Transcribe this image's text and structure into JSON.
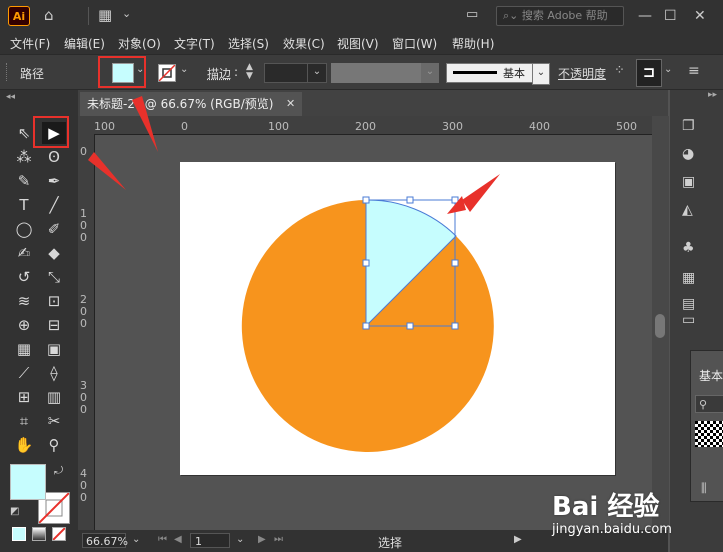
{
  "app": {
    "logo": "Ai",
    "search_placeholder": "搜索 Adobe 帮助"
  },
  "menu": {
    "items": [
      "文件(F)",
      "编辑(E)",
      "对象(O)",
      "文字(T)",
      "选择(S)",
      "效果(C)",
      "视图(V)",
      "窗口(W)",
      "帮助(H)"
    ]
  },
  "control": {
    "selection_label": "路径",
    "stroke_label": "描边",
    "stroke_profile": "基本",
    "opacity_label": "不透明度"
  },
  "document": {
    "tab_title": "未标题-2* @ 66.67% (RGB/预览)"
  },
  "rulers": {
    "h_labels": [
      "100",
      "0",
      "100",
      "200",
      "300",
      "400",
      "500"
    ],
    "v_labels": [
      "0",
      "1 0 0",
      "2 0 0",
      "3 0 0",
      "4 0 0"
    ]
  },
  "status": {
    "zoom": "66.67%",
    "page": "1",
    "tool_name": "选择"
  },
  "panels": {
    "swatch_label": "基本"
  },
  "watermark": {
    "brand": "Bai 经验",
    "url": "jingyan.baidu.com"
  },
  "colors": {
    "fill": "#c6fdfe",
    "pie": "#f7941d",
    "selection": "#4a7bd6",
    "highlight": "#e8312b"
  }
}
